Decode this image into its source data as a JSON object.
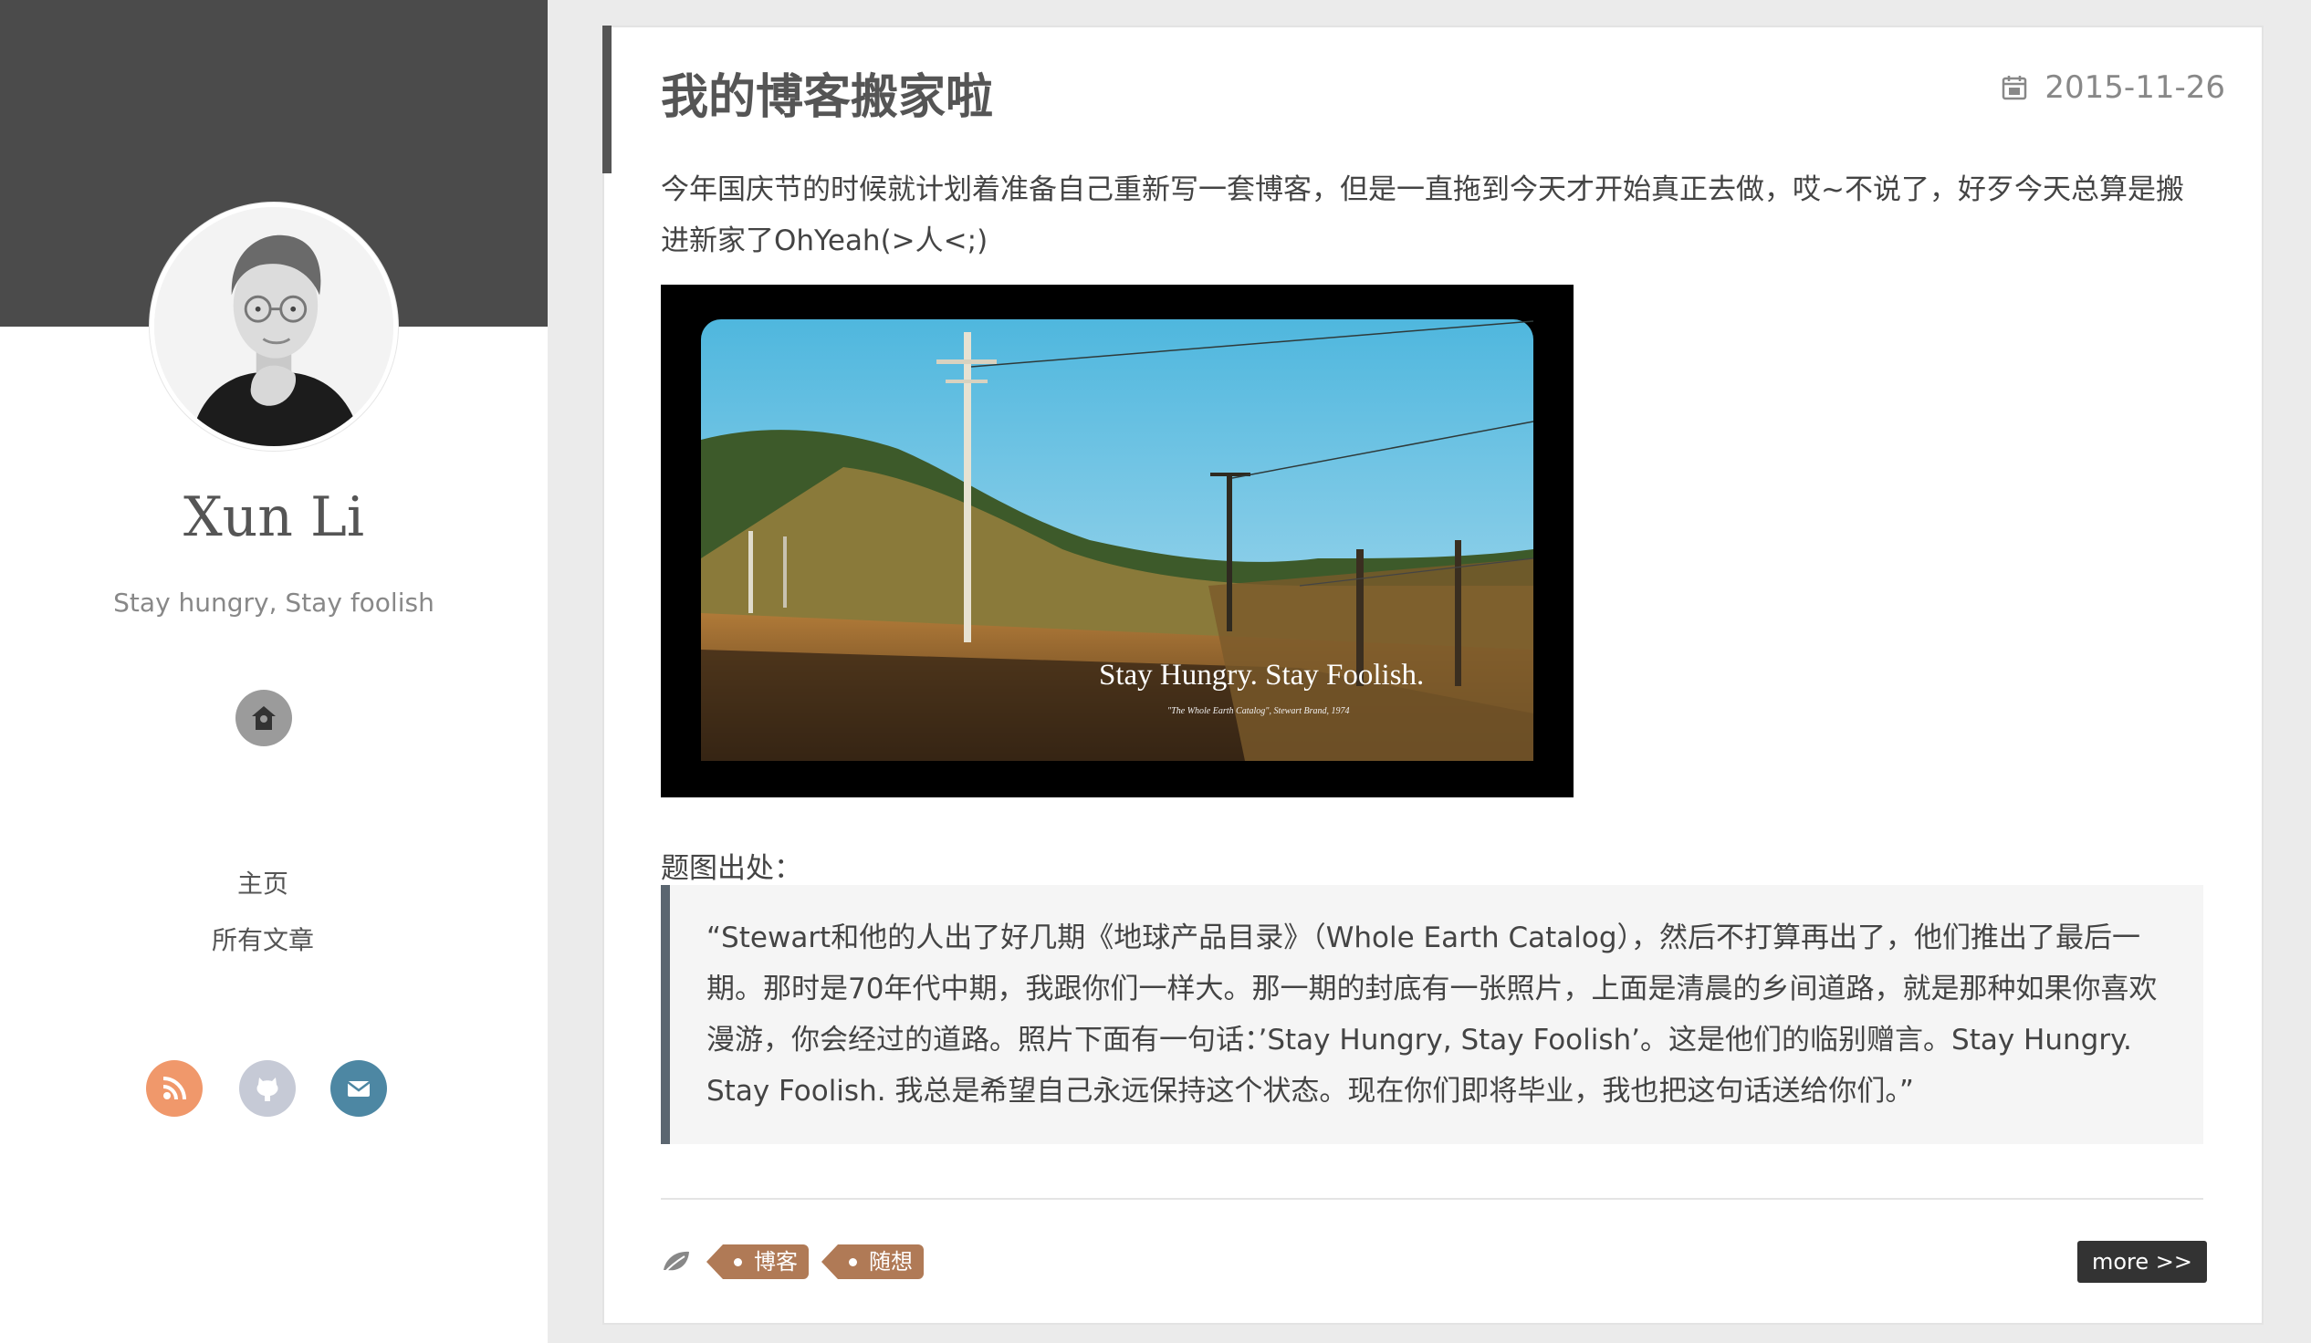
{
  "sidebar": {
    "author_name": "Xun Li",
    "motto": "Stay hungry, Stay foolish",
    "nav": [
      {
        "label": "主页"
      },
      {
        "label": "所有文章"
      }
    ],
    "social_icons": [
      "rss-icon",
      "github-icon",
      "mail-icon"
    ],
    "colors": {
      "banner": "#4b4b4b",
      "rss": "#f0986b",
      "github": "#c6cad6",
      "mail": "#4d87a3"
    }
  },
  "post": {
    "title": "我的博客搬家啦",
    "date": "2015-11-26",
    "intro": "今年国庆节的时候就计划着准备自己重新写一套博客，但是一直拖到今天才开始真正去做，哎~不说了，好歹今天总算是搬进新家了OhYeah(>人<;)",
    "image": {
      "overlay_text": "Stay Hungry. Stay Foolish.",
      "overlay_subtext": "\"The Whole Earth Catalog\", Stewart Brand, 1974"
    },
    "image_caption": "题图出处：",
    "quote": "“Stewart和他的人出了好几期《地球产品目录》（Whole Earth Catalog），然后不打算再出了，他们推出了最后一期。那时是70年代中期，我跟你们一样大。那一期的封底有一张照片，上面是清晨的乡间道路，就是那种如果你喜欢漫游，你会经过的道路。照片下面有一句话：’Stay Hungry, Stay Foolish’。这是他们的临别赠言。Stay Hungry. Stay Foolish. 我总是希望自己永远保持这个状态。现在你们即将毕业，我也把这句话送给你们。”",
    "tags": [
      {
        "label": "博客"
      },
      {
        "label": "随想"
      }
    ],
    "more_label": "more >>",
    "colors": {
      "tag": "#b07a56",
      "quote_border": "#5b6670",
      "more_button": "#333333"
    }
  }
}
